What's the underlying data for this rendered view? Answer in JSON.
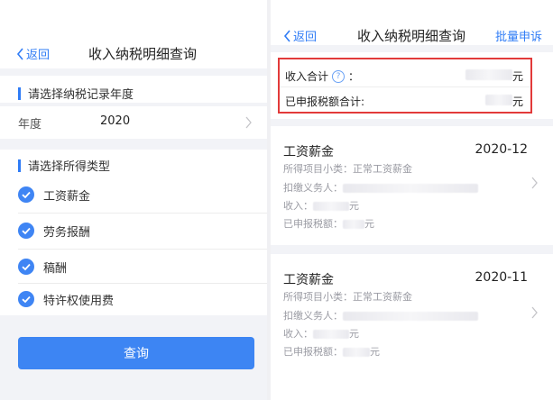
{
  "left": {
    "back_label": "返回",
    "title": "收入纳税明细查询",
    "section_year_title": "请选择纳税记录年度",
    "year_label": "年度",
    "year_value": "2020",
    "section_type_title": "请选择所得类型",
    "income_types": [
      {
        "label": "工资薪金",
        "checked": true
      },
      {
        "label": "劳务报酬",
        "checked": true
      },
      {
        "label": "稿酬",
        "checked": true
      },
      {
        "label": "特许权使用费",
        "checked": true
      }
    ],
    "query_button": "查询"
  },
  "right": {
    "back_label": "返回",
    "title": "收入纳税明细查询",
    "batch_appeal": "批量申诉",
    "summary": {
      "income_total_label": "收入合计",
      "income_total_colon": "：",
      "income_total_suffix": "元",
      "declared_tax_label": "已申报税额合计:",
      "declared_tax_suffix": "元"
    },
    "records": [
      {
        "category": "工资薪金",
        "period": "2020-12",
        "subcategory_label": "所得项目小类：正常工资薪金",
        "withholder_label": "扣缴义务人：",
        "income_label": "收入：",
        "income_suffix": "元",
        "tax_label": "已申报税额：",
        "tax_suffix": "元"
      },
      {
        "category": "工资薪金",
        "period": "2020-11",
        "subcategory_label": "所得项目小类：正常工资薪金",
        "withholder_label": "扣缴义务人：",
        "income_label": "收入：",
        "income_suffix": "元",
        "tax_label": "已申报税额：",
        "tax_suffix": "元"
      }
    ]
  },
  "colors": {
    "accent": "#2f7cf6",
    "button": "#3d85f3",
    "highlight_border": "#e23a3a",
    "section_bg": "#f2f3f7"
  }
}
